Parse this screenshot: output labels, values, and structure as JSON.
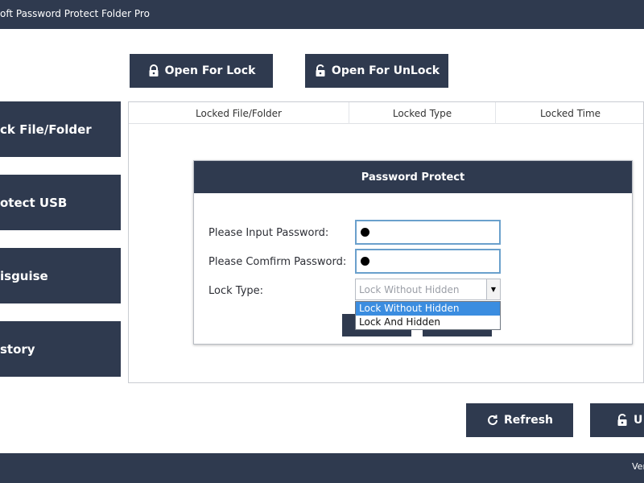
{
  "window": {
    "title": "oft Password Protect Folder Pro"
  },
  "toolbar": {
    "open_for_lock": "Open For Lock",
    "open_for_unlock": "Open For UnLock"
  },
  "sidebar": {
    "items": [
      {
        "label": "ck File/Folder"
      },
      {
        "label": "otect USB"
      },
      {
        "label": "isguise"
      },
      {
        "label": "story"
      }
    ]
  },
  "table": {
    "columns": [
      "Locked File/Folder",
      "Locked Type",
      "Locked Time"
    ]
  },
  "dialog": {
    "title": "Password Protect",
    "password_label": "Please Input Password:",
    "confirm_label": "Please Comfirm Password:",
    "lock_type_label": "Lock Type:",
    "lock_type_value": "Lock Without Hidden",
    "options": [
      "Lock Without Hidden",
      "Lock And Hidden"
    ]
  },
  "bottom": {
    "refresh": "Refresh",
    "unlock_partial": "U"
  },
  "status": {
    "version_partial": "Ver"
  },
  "colors": {
    "navy": "#2f3a4f",
    "input_border": "#6aa0cc",
    "selection": "#3b8de0"
  },
  "icons": {
    "lock": "lock-icon",
    "unlock": "unlock-icon",
    "refresh": "refresh-icon",
    "dropdown": "chevron-down-icon"
  }
}
